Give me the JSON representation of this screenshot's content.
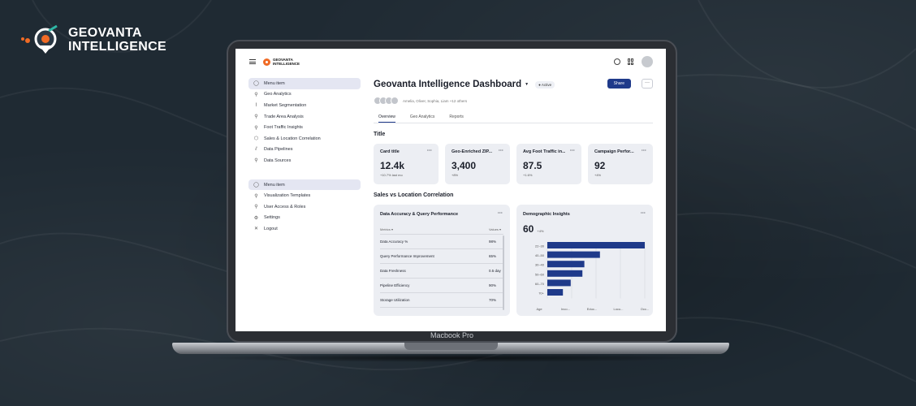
{
  "brand": {
    "line1": "GEOVANTA",
    "line2": "INTELLIGENCE"
  },
  "laptop_label": "Macbook Pro",
  "app": {
    "logo_line1": "GEOVANTA",
    "logo_line2": "INTELLIGENCE"
  },
  "sidebar": {
    "group1": [
      {
        "label": "Menu item",
        "icon": "circle-icon",
        "active": true
      },
      {
        "label": "Geo Analytics",
        "icon": "wrench-icon"
      },
      {
        "label": "Market Segmentation",
        "icon": "paperclip-icon"
      },
      {
        "label": "Trade Area Analysis",
        "icon": "wrench-icon"
      },
      {
        "label": "Foot Traffic Insights",
        "icon": "wrench-icon"
      },
      {
        "label": "Sales & Location Correlation",
        "icon": "cube-icon"
      },
      {
        "label": "Data Pipelines",
        "icon": "pipe-icon"
      },
      {
        "label": "Data Sources",
        "icon": "wrench-icon"
      }
    ],
    "group2": [
      {
        "label": "Menu item",
        "icon": "circle-icon",
        "active": true
      },
      {
        "label": "Visualization Templates",
        "icon": "wrench-icon"
      },
      {
        "label": "User Access & Roles",
        "icon": "wrench-icon"
      },
      {
        "label": "Settings",
        "icon": "gear-icon"
      },
      {
        "label": "Logout",
        "icon": "close-icon"
      }
    ]
  },
  "header": {
    "title": "Geovanta Intelligence Dashboard",
    "status": "Active",
    "share_label": "Share",
    "more_label": "···",
    "people_text": "Amelia, Oliver, Sophia, Liam +12 others"
  },
  "tabs": [
    "Overview",
    "Geo Analytics",
    "Reports"
  ],
  "section1_title": "Title",
  "cards": [
    {
      "title": "Card title",
      "value": "12.4k",
      "sub": "+10.7% last mo"
    },
    {
      "title": "Geo-Enriched ZIP...",
      "value": "3,400",
      "sub": "+8%"
    },
    {
      "title": "Avg Foot Traffic in...",
      "value": "87.5",
      "sub": "+1.6%"
    },
    {
      "title": "Campaign Perfor...",
      "value": "92",
      "sub": "+4%"
    }
  ],
  "section2_title": "Sales vs Location Correlation",
  "table_panel": {
    "title": "Data Accuracy & Query Performance",
    "col_metric": "Metrics",
    "col_value": "Values",
    "rows": [
      {
        "metric": "Data Accuracy %",
        "value": "98%"
      },
      {
        "metric": "Query Performance Improvement",
        "value": "65%"
      },
      {
        "metric": "Data Freshness",
        "value": "0.5 day"
      },
      {
        "metric": "Pipeline Efficiency",
        "value": "90%"
      },
      {
        "metric": "Storage Utilization",
        "value": "70%"
      }
    ]
  },
  "demo_panel": {
    "title": "Demographic Insights",
    "value": "60",
    "delta": "+4%"
  },
  "chart_data": {
    "type": "bar",
    "orientation": "horizontal",
    "categories": [
      "22–30",
      "40–50",
      "30–40",
      "50–60",
      "60–70",
      "70+"
    ],
    "values": [
      100,
      54,
      38,
      36,
      24,
      16
    ],
    "xaxis_labels": [
      "Age",
      "Inco...",
      "Educ...",
      "Locu...",
      "Occ..."
    ],
    "color": "#1f3a8a",
    "grid": true
  },
  "colors": {
    "accent": "#1f3a8a",
    "brand_orange": "#f06b25",
    "brand_teal": "#2fb7a6"
  }
}
